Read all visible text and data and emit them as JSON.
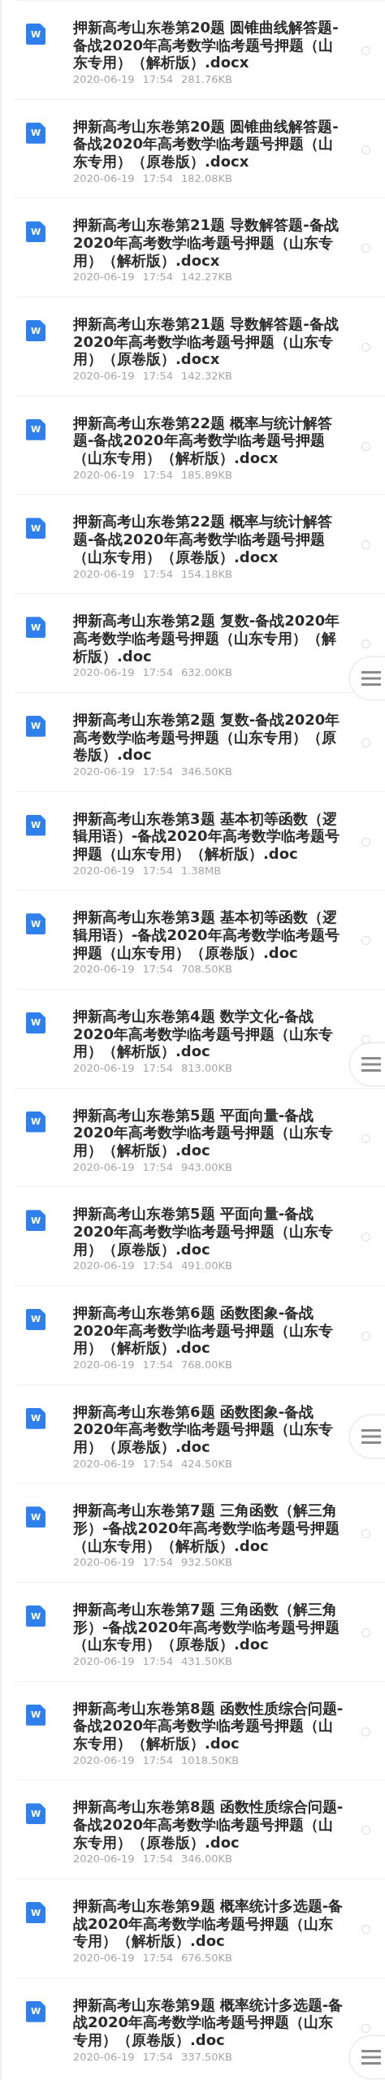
{
  "files": [
    {
      "icon": "W",
      "name": "押新高考山东卷第20题 圆锥曲线解答题-备战2020年高考数学临考题号押题（山东专用）（解析版）.docx",
      "date": "2020-06-19",
      "time": "17:54",
      "size": "281.76KB",
      "checked": false
    },
    {
      "icon": "W",
      "name": "押新高考山东卷第20题 圆锥曲线解答题-备战2020年高考数学临考题号押题（山东专用）（原卷版）.docx",
      "date": "2020-06-19",
      "time": "17:54",
      "size": "182.08KB",
      "checked": false
    },
    {
      "icon": "W",
      "name": "押新高考山东卷第21题 导数解答题-备战2020年高考数学临考题号押题（山东专用）（解析版）.docx",
      "date": "2020-06-19",
      "time": "17:54",
      "size": "142.27KB",
      "checked": false
    },
    {
      "icon": "W",
      "name": "押新高考山东卷第21题 导数解答题-备战2020年高考数学临考题号押题（山东专用）（原卷版）.docx",
      "date": "2020-06-19",
      "time": "17:54",
      "size": "142.32KB",
      "checked": false
    },
    {
      "icon": "W",
      "name": "押新高考山东卷第22题 概率与统计解答题-备战2020年高考数学临考题号押题（山东专用）（解析版）.docx",
      "date": "2020-06-19",
      "time": "17:54",
      "size": "185.89KB",
      "checked": false
    },
    {
      "icon": "W",
      "name": "押新高考山东卷第22题 概率与统计解答题-备战2020年高考数学临考题号押题（山东专用）（原卷版）.docx",
      "date": "2020-06-19",
      "time": "17:54",
      "size": "154.18KB",
      "checked": false
    },
    {
      "icon": "W",
      "name": "押新高考山东卷第2题 复数-备战2020年高考数学临考题号押题（山东专用）（解析版）.doc",
      "date": "2020-06-19",
      "time": "17:54",
      "size": "632.00KB",
      "checked": false
    },
    {
      "icon": "W",
      "name": "押新高考山东卷第2题 复数-备战2020年高考数学临考题号押题（山东专用）（原卷版）.doc",
      "date": "2020-06-19",
      "time": "17:54",
      "size": "346.50KB",
      "checked": false
    },
    {
      "icon": "W",
      "name": "押新高考山东卷第3题 基本初等函数（逻辑用语）-备战2020年高考数学临考题号押题（山东专用）（解析版）.doc",
      "date": "2020-06-19",
      "time": "17:54",
      "size": "1.38MB",
      "checked": false
    },
    {
      "icon": "W",
      "name": "押新高考山东卷第3题 基本初等函数（逻辑用语）-备战2020年高考数学临考题号押题（山东专用）（原卷版）.doc",
      "date": "2020-06-19",
      "time": "17:54",
      "size": "708.50KB",
      "checked": false
    },
    {
      "icon": "W",
      "name": "押新高考山东卷第4题 数学文化-备战2020年高考数学临考题号押题（山东专用）（解析版）.doc",
      "date": "2020-06-19",
      "time": "17:54",
      "size": "813.00KB",
      "checked": false
    },
    {
      "icon": "W",
      "name": "押新高考山东卷第5题 平面向量-备战2020年高考数学临考题号押题（山东专用）（解析版）.doc",
      "date": "2020-06-19",
      "time": "17:54",
      "size": "943.00KB",
      "checked": false
    },
    {
      "icon": "W",
      "name": "押新高考山东卷第5题 平面向量-备战2020年高考数学临考题号押题（山东专用）（原卷版）.doc",
      "date": "2020-06-19",
      "time": "17:54",
      "size": "491.00KB",
      "checked": false
    },
    {
      "icon": "W",
      "name": "押新高考山东卷第6题 函数图象-备战2020年高考数学临考题号押题（山东专用）（解析版）.doc",
      "date": "2020-06-19",
      "time": "17:54",
      "size": "768.00KB",
      "checked": false
    },
    {
      "icon": "W",
      "name": "押新高考山东卷第6题 函数图象-备战2020年高考数学临考题号押题（山东专用）（原卷版）.doc",
      "date": "2020-06-19",
      "time": "17:54",
      "size": "424.50KB"
    },
    {
      "icon": "W",
      "name": "押新高考山东卷第7题 三角函数（解三角形）-备战2020年高考数学临考题号押题（山东专用）（解析版）.doc",
      "date": "2020-06-19",
      "time": "17:54",
      "size": "932.50KB",
      "checked": false
    },
    {
      "icon": "W",
      "name": "押新高考山东卷第7题 三角函数（解三角形）-备战2020年高考数学临考题号押题（山东专用）（原卷版）.doc",
      "date": "2020-06-19",
      "time": "17:54",
      "size": "431.50KB",
      "checked": false
    },
    {
      "icon": "W",
      "name": "押新高考山东卷第8题 函数性质综合问题-备战2020年高考数学临考题号押题（山东专用）（解析版）.doc",
      "date": "2020-06-19",
      "time": "17:54",
      "size": "1018.50KB",
      "checked": false
    },
    {
      "icon": "W",
      "name": "押新高考山东卷第8题 函数性质综合问题-备战2020年高考数学临考题号押题（山东专用）（原卷版）.doc",
      "date": "2020-06-19",
      "time": "17:54",
      "size": "346.00KB",
      "checked": false
    },
    {
      "icon": "W",
      "name": "押新高考山东卷第9题 概率统计多选题-备战2020年高考数学临考题号押题（山东专用）（解析版）.doc",
      "date": "2020-06-19",
      "time": "17:54",
      "size": "676.50KB",
      "checked": false
    },
    {
      "icon": "W",
      "name": "押新高考山东卷第9题 概率统计多选题-备战2020年高考数学临考题号押题（山东专用）（原卷版）.doc",
      "date": "2020-06-19",
      "time": "17:54",
      "size": "337.50KB",
      "checked": false
    }
  ]
}
